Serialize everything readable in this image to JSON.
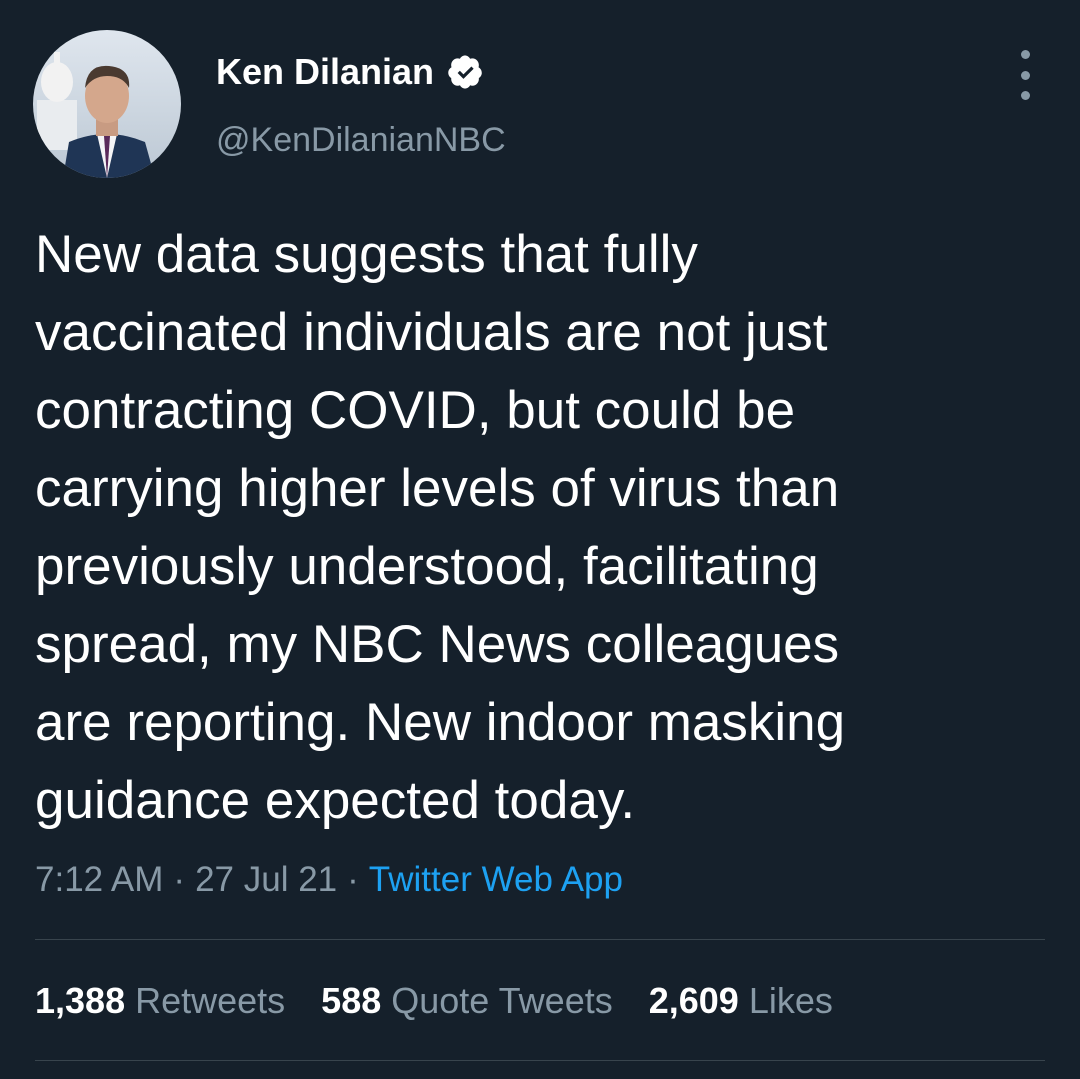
{
  "author": {
    "display_name": "Ken Dilanian",
    "handle": "@KenDilanianNBC",
    "verified_icon": "verified-badge-icon"
  },
  "tweet": {
    "text": "New data suggests that fully\nvaccinated individuals are not just\ncontracting COVID, but could be\ncarrying higher levels of virus than\npreviously understood, facilitating\nspread, my NBC News colleagues\nare reporting.  New indoor masking\nguidance expected today.",
    "time": "7:12 AM",
    "separator": "·",
    "date": "27 Jul 21",
    "source": "Twitter Web App"
  },
  "stats": {
    "retweets_count": "1,388",
    "retweets_label": "Retweets",
    "quotes_count": "588",
    "quotes_label": "Quote Tweets",
    "likes_count": "2,609",
    "likes_label": "Likes"
  },
  "colors": {
    "background": "#15202b",
    "text": "#ffffff",
    "secondary": "#8899a6",
    "accent": "#1da1f2",
    "divider": "#38444d"
  }
}
